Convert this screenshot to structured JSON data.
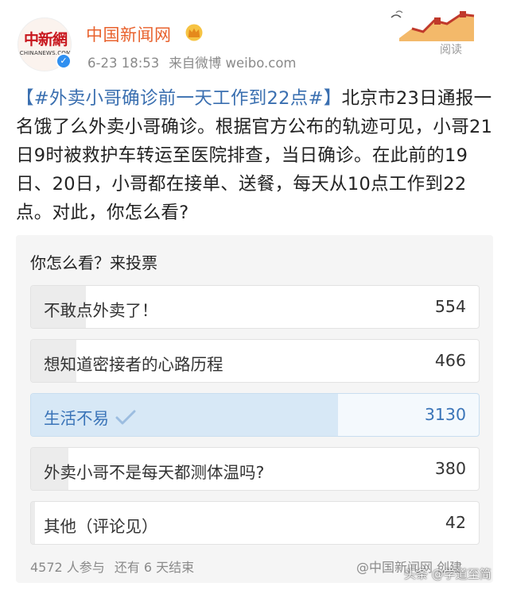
{
  "author": {
    "name": "中国新闻网",
    "avatar_logo_cn": "中新網",
    "avatar_logo_en": "CHINANEWS.COM",
    "timestamp": "6-23 18:53",
    "source": "来自微博 weibo.com",
    "badge_icon": "crown-icon",
    "verified_icon": "verified-check-icon"
  },
  "banner": {
    "read_label": "阅读"
  },
  "post": {
    "topic": "【#外卖小哥确诊前一天工作到22点#】",
    "body": "北京市23日通报一名饿了么外卖小哥确诊。根据官方公布的轨迹可见，小哥21日9时被救护车转运至医院排查，当日确诊。在此前的19日、20日，小哥都在接单、送餐，每天从10点工作到22点。对此，你怎么看?"
  },
  "poll": {
    "title": "你怎么看？来投票",
    "options": [
      {
        "label": "不敢点外卖了！",
        "count": "554",
        "share": 0.122,
        "selected": false
      },
      {
        "label": "想知道密接者的心路历程",
        "count": "466",
        "share": 0.102,
        "selected": false
      },
      {
        "label": "生活不易",
        "count": "3130",
        "share": 0.685,
        "selected": true
      },
      {
        "label": "外卖小哥不是每天都测体温吗?",
        "count": "380",
        "share": 0.083,
        "selected": false
      },
      {
        "label": "其他（评论见）",
        "count": "42",
        "share": 0.009,
        "selected": false
      }
    ],
    "participants": "4572 人参与",
    "remaining": "还有 6 天结束",
    "credit": "@中国新闻网 创建"
  },
  "watermark": "头条 @学道至简",
  "colors": {
    "username": "#e8612c",
    "topic": "#3a6fb0",
    "selected_fill": "#d7e8f6",
    "verified": "#2f8ff0"
  }
}
